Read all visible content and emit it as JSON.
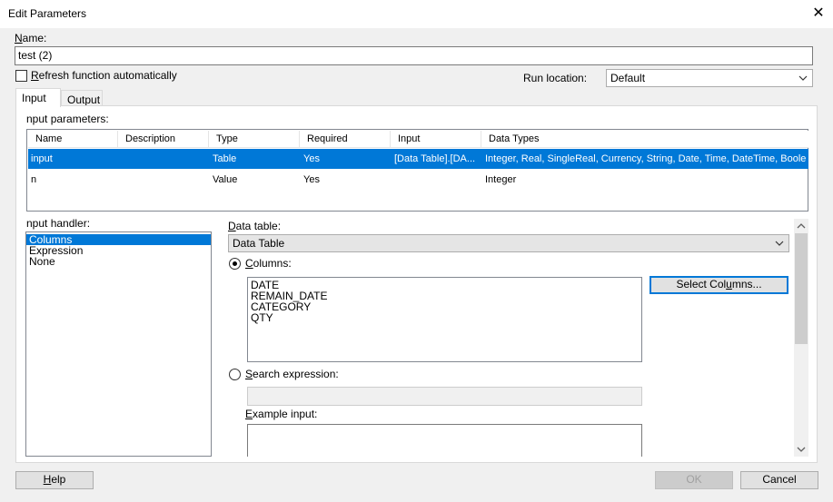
{
  "window": {
    "title": "Edit Parameters",
    "close_glyph": "✕"
  },
  "name_field": {
    "label_accel": "N",
    "label_rest": "ame:",
    "value": "test (2)"
  },
  "refresh": {
    "label_accel": "R",
    "label_rest": "efresh function automatically",
    "checked": false
  },
  "run_location": {
    "label": "Run location:",
    "value": "Default"
  },
  "tabs": [
    {
      "label": "Input",
      "active": true
    },
    {
      "label": "Output",
      "active": false
    }
  ],
  "input_parameters": {
    "label": "nput parameters:",
    "columns": [
      "Name",
      "Description",
      "Type",
      "Required",
      "Input",
      "Data Types"
    ],
    "rows": [
      {
        "name": "input",
        "description": "",
        "type": "Table",
        "required": "Yes",
        "input": "[Data Table].[DA...",
        "data_types": "Integer, Real, SingleReal, Currency, String, Date, Time, DateTime, Boole...",
        "selected": true
      },
      {
        "name": "n",
        "description": "",
        "type": "Value",
        "required": "Yes",
        "input": "",
        "data_types": "Integer",
        "selected": false
      }
    ]
  },
  "input_handler": {
    "label": "nput handler:",
    "items": [
      {
        "label": "Columns",
        "selected": true
      },
      {
        "label": "Expression",
        "selected": false
      },
      {
        "label": "None",
        "selected": false
      }
    ]
  },
  "data_table": {
    "label_accel": "D",
    "label_rest": "ata table:",
    "value": "Data Table"
  },
  "columns_option": {
    "label_accel": "C",
    "label_rest": "olumns:",
    "selected": true,
    "items": [
      "DATE",
      "REMAIN_DATE",
      "CATEGORY",
      "QTY"
    ]
  },
  "select_columns_button": {
    "label_pre": "Select Col",
    "label_accel": "u",
    "label_post": "mns..."
  },
  "search_expression": {
    "label_accel": "S",
    "label_rest": "earch expression:",
    "selected": false,
    "value": ""
  },
  "example_input": {
    "label_accel": "E",
    "label_rest": "xample input:",
    "value": ""
  },
  "buttons": {
    "help_accel": "H",
    "help_rest": "elp",
    "ok": "OK",
    "cancel": "Cancel"
  }
}
